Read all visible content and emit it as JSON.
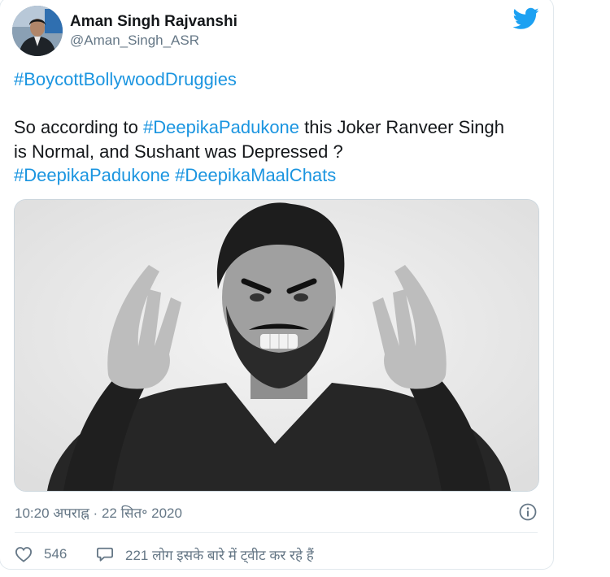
{
  "tweet": {
    "user": {
      "display_name": "Aman Singh Rajvanshi",
      "handle": "@Aman_Singh_ASR"
    },
    "text": {
      "hashtag_line": "#BoycottBollywoodDruggies",
      "line1_prefix": "So according to ",
      "line1_tag": "#DeepikaPadukone",
      "line1_suffix": " this Joker Ranveer Singh",
      "line2": "is Normal, and Sushant was Depressed ?",
      "tag_a": "#DeepikaPadukone",
      "tag_sep": " ",
      "tag_b": "#DeepikaMaalChats"
    },
    "timestamp": "10:20 अपराह्न · 22 सित॰ 2020",
    "likes": "546",
    "reply_text": "221 लोग इसके बारे में ट्वीट कर रहे हैं"
  },
  "colors": {
    "link": "#1b95e0",
    "twitter_blue": "#1da1f2",
    "muted": "#657786",
    "text": "#14171a"
  },
  "icons": [
    "twitter-bird-icon",
    "info-icon",
    "heart-icon",
    "reply-bubble-icon"
  ]
}
